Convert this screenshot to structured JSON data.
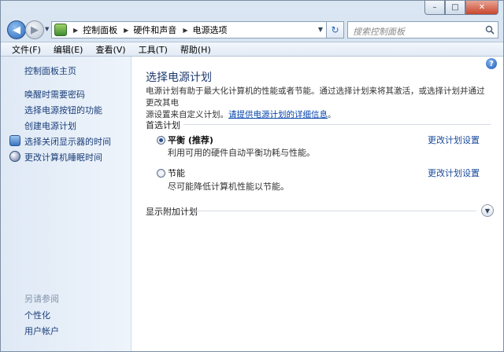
{
  "window": {
    "minimize": "–",
    "maximize": "□",
    "close": "✕"
  },
  "nav": {
    "back": "◀",
    "forward": "▶",
    "breadcrumb": [
      "控制面板",
      "硬件和声音",
      "电源选项"
    ],
    "search_placeholder": "搜索控制面板",
    "refresh": "↻"
  },
  "menu": {
    "items": [
      "文件(F)",
      "编辑(E)",
      "查看(V)",
      "工具(T)",
      "帮助(H)"
    ]
  },
  "sidebar": {
    "home": "控制面板主页",
    "links": [
      "唤醒时需要密码",
      "选择电源按钮的功能",
      "创建电源计划",
      "选择关闭显示器的时间",
      "更改计算机睡眠时间"
    ],
    "see_also_title": "另请参阅",
    "see_also": [
      "个性化",
      "用户帐户"
    ]
  },
  "main": {
    "help": "?",
    "title": "选择电源计划",
    "desc_line1": "电源计划有助于最大化计算机的性能或者节能。通过选择计划来将其激活，或选择计划并通过更改其电",
    "desc_line2": "源设置来自定义计划。",
    "desc_link": "请提供电源计划的详细信息",
    "desc_end": "。",
    "preferred_title": "首选计划",
    "plans": [
      {
        "name": "平衡 (推荐)",
        "desc": "利用可用的硬件自动平衡功耗与性能。",
        "link": "更改计划设置",
        "selected": true
      },
      {
        "name": "节能",
        "desc": "尽可能降低计算机性能以节能。",
        "link": "更改计划设置",
        "selected": false
      }
    ],
    "additional_title": "显示附加计划"
  },
  "colors": {
    "link": "#1a4a9a",
    "title": "#1e3a6e"
  }
}
